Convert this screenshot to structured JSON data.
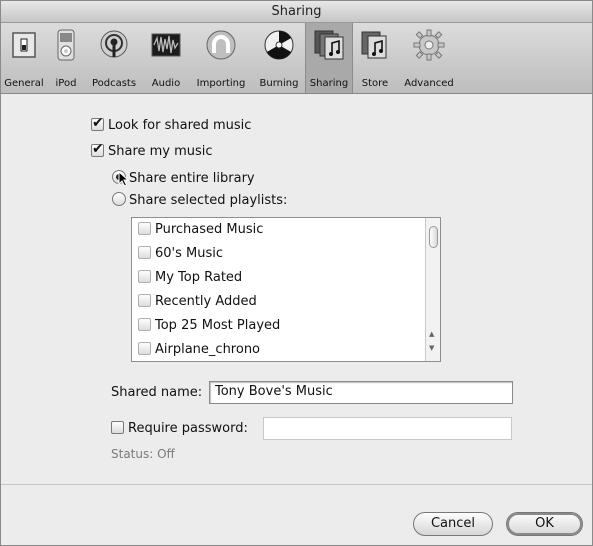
{
  "window": {
    "title": "Sharing"
  },
  "toolbar": {
    "items": [
      {
        "label": "General",
        "icon": "general-switch-icon"
      },
      {
        "label": "iPod",
        "icon": "ipod-icon"
      },
      {
        "label": "Podcasts",
        "icon": "podcast-icon"
      },
      {
        "label": "Audio",
        "icon": "audio-waveform-icon"
      },
      {
        "label": "Importing",
        "icon": "importing-icon"
      },
      {
        "label": "Burning",
        "icon": "burning-disc-icon"
      },
      {
        "label": "Sharing",
        "icon": "sharing-music-icon",
        "selected": true
      },
      {
        "label": "Store",
        "icon": "store-icon"
      },
      {
        "label": "Advanced",
        "icon": "gear-icon"
      }
    ]
  },
  "options": {
    "look_for_shared": {
      "label": "Look for shared music",
      "checked": true
    },
    "share_my_music": {
      "label": "Share my music",
      "checked": true
    },
    "share_entire": {
      "label": "Share entire library",
      "selected": true
    },
    "share_selected": {
      "label": "Share selected playlists:",
      "selected": false
    }
  },
  "playlists": [
    {
      "label": "Purchased Music",
      "checked": false
    },
    {
      "label": "60's Music",
      "checked": false
    },
    {
      "label": "My Top Rated",
      "checked": false
    },
    {
      "label": "Recently Added",
      "checked": false
    },
    {
      "label": "Top 25 Most Played",
      "checked": false
    },
    {
      "label": "Airplane_chrono",
      "checked": false
    }
  ],
  "shared_name": {
    "label": "Shared name:",
    "value": "Tony Bove's Music"
  },
  "require_password": {
    "label": "Require password:",
    "checked": false,
    "value": ""
  },
  "status": "Status: Off",
  "buttons": {
    "cancel": "Cancel",
    "ok": "OK"
  },
  "colors": {
    "selected_tab": "#a9a9a9",
    "window_bg": "#ececec"
  }
}
